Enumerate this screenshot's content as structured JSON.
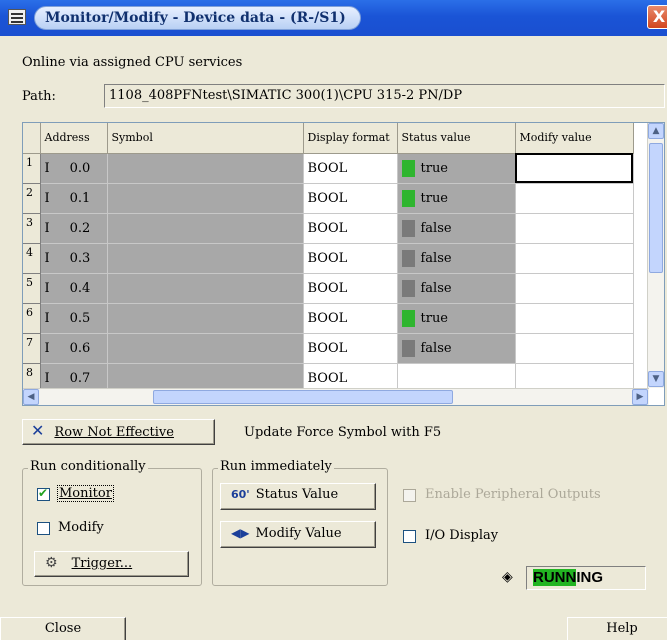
{
  "window": {
    "title": "Monitor/Modify - Device data - (R-/S1)",
    "close_glyph": "X"
  },
  "connection_text": "Online via assigned CPU services",
  "path": {
    "label": "Path:",
    "value": "1108_408PFNtest\\SIMATIC 300(1)\\CPU 315-2 PN/DP"
  },
  "table": {
    "columns": [
      "",
      "Address",
      "Symbol",
      "Display format",
      "Status value",
      "Modify value"
    ],
    "rows": [
      {
        "num": "1",
        "area": "I",
        "addr": "0.0",
        "symbol": "",
        "format": "BOOL",
        "status": "true",
        "modify": ""
      },
      {
        "num": "2",
        "area": "I",
        "addr": "0.1",
        "symbol": "",
        "format": "BOOL",
        "status": "true",
        "modify": ""
      },
      {
        "num": "3",
        "area": "I",
        "addr": "0.2",
        "symbol": "",
        "format": "BOOL",
        "status": "false",
        "modify": ""
      },
      {
        "num": "4",
        "area": "I",
        "addr": "0.3",
        "symbol": "",
        "format": "BOOL",
        "status": "false",
        "modify": ""
      },
      {
        "num": "5",
        "area": "I",
        "addr": "0.4",
        "symbol": "",
        "format": "BOOL",
        "status": "false",
        "modify": ""
      },
      {
        "num": "6",
        "area": "I",
        "addr": "0.5",
        "symbol": "",
        "format": "BOOL",
        "status": "true",
        "modify": ""
      },
      {
        "num": "7",
        "area": "I",
        "addr": "0.6",
        "symbol": "",
        "format": "BOOL",
        "status": "false",
        "modify": ""
      },
      {
        "num": "8",
        "area": "I",
        "addr": "0.7",
        "symbol": "",
        "format": "BOOL",
        "status": "",
        "modify": ""
      }
    ],
    "status_colors": {
      "true": "#2fb52f",
      "false": "#7a7a7a"
    }
  },
  "row_not_effective_label": "Row Not Effective",
  "update_force_text": "Update Force Symbol with F5",
  "run_conditionally": {
    "label": "Run conditionally",
    "monitor": {
      "label": "Monitor",
      "checked": true
    },
    "modify": {
      "label": "Modify",
      "checked": false
    },
    "trigger_label": "Trigger..."
  },
  "run_immediately": {
    "label": "Run immediately",
    "status_value_label": "Status Value",
    "modify_value_label": "Modify Value"
  },
  "enable_peripheral_outputs": {
    "label": "Enable Peripheral Outputs",
    "checked": false,
    "enabled": false
  },
  "io_display": {
    "label": "I/O Display",
    "checked": false
  },
  "status": {
    "text": "RUNNING",
    "color": "#22b422"
  },
  "bottom": {
    "close_label": "Close",
    "help_label": "Help"
  }
}
